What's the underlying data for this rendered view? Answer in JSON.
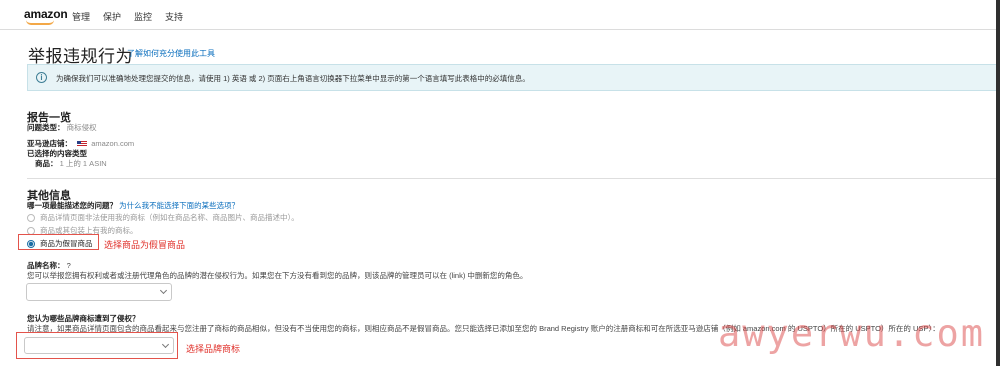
{
  "header": {
    "logo_text": "amazon",
    "nav": [
      "管理",
      "保护",
      "监控",
      "支持"
    ]
  },
  "page": {
    "title": "举报违规行为",
    "learn_link": "了解如何充分使用此工具"
  },
  "info": {
    "text": "为确保我们可以准确地处理您提交的信息，请使用 1) 英语 或 2) 页面右上角语言切换器下拉菜单中显示的第一个语言填写此表格中的必填信息。"
  },
  "report_summary": {
    "title": "报告一览",
    "issue_type_label": "问题类型：",
    "issue_type_value": "商标侵权",
    "store_label": "亚马逊店铺：",
    "store_value": "amazon.com",
    "content_type_label": "已选择的内容类型",
    "product_label": "商品：",
    "product_value": "1 上的 1 ASIN"
  },
  "other_info": {
    "title": "其他信息",
    "question_label": "哪一项最能描述您的问题？",
    "question_link": "为什么我不能选择下面的某些选项？",
    "options": [
      "商品详情页面非法使用我的商标（例如在商品名称、商品图片、商品描述中）。",
      "商品或其包装上有我的商标。",
      "商品为假冒商品"
    ],
    "selected_index": 2,
    "annotation_1": "选择商品为假冒商品",
    "brand_label": "品牌名称：",
    "brand_help": "?",
    "brand_desc": "您可以举报您拥有权利或者或注册代理角色的品牌的潜在侵权行为。如果您在下方没有看到您的品牌，则该品牌的管理员可以在 (link) 中删新您的角色。",
    "trademark_q": "您认为哪些品牌商标遭到了侵权？",
    "trademark_desc": "请注意，如果商品详情页面包含的商品看起来与您注册了商标的商品相似，但没有不当使用您的商标，则相应商品不是假冒商品。您只能选择已添加至您的 Brand Registry 账户的注册商标和可在所选亚马逊店铺（例如 amazon.com 的 USPTO）所在的 USPTO）所在的 USP）：",
    "annotation_2": "选择品牌商标"
  },
  "watermark": "awyerwu.com",
  "colors": {
    "link": "#0a6ebd",
    "annotation": "#e0302a",
    "info_bg": "#e8f4f7",
    "selected_radio": "#1c6ea4"
  }
}
